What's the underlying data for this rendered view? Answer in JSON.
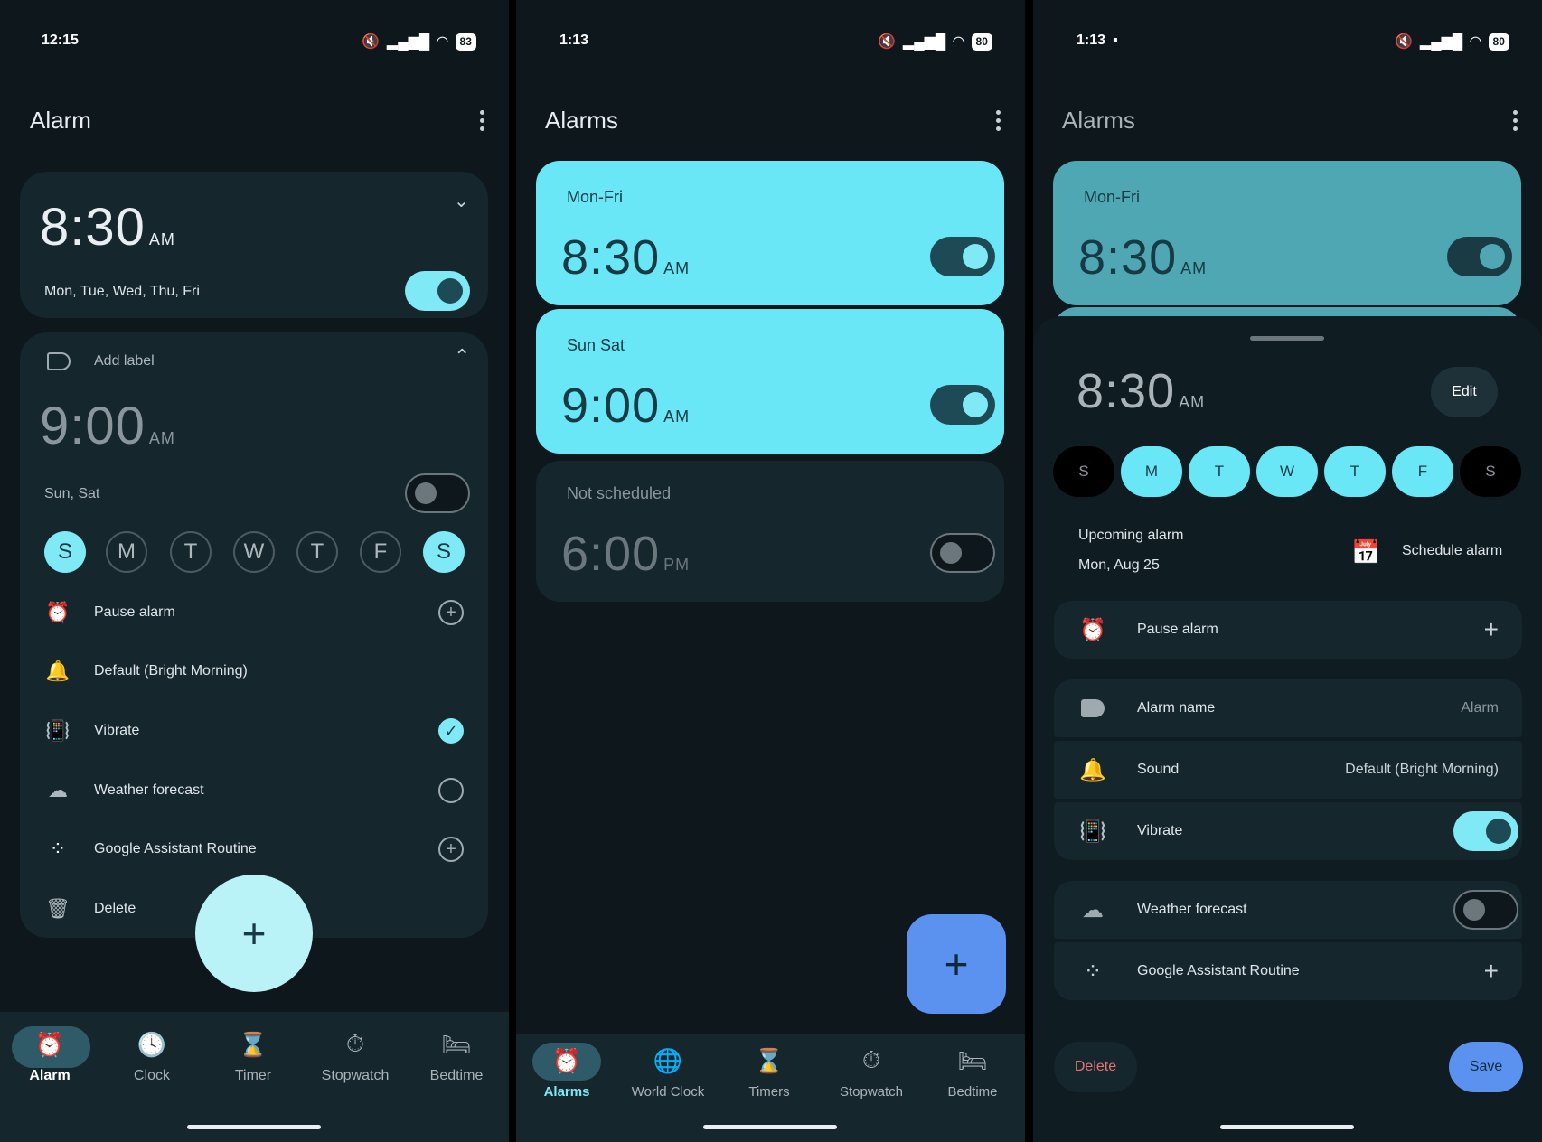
{
  "colors": {
    "accent": "#7feaf6",
    "card_active": "#6ae7f7",
    "fab_blue": "#5b92f0",
    "delete_red": "#e57373"
  },
  "s1": {
    "status": {
      "time": "12:15",
      "battery": "83"
    },
    "title": "Alarm",
    "alarm1": {
      "time": "8:30",
      "ampm": "AM",
      "days": "Mon, Tue, Wed, Thu, Fri",
      "enabled": true
    },
    "alarm2": {
      "label": "Add label",
      "time": "9:00",
      "ampm": "AM",
      "days": "Sun, Sat",
      "enabled": false
    },
    "day_letters": [
      "S",
      "M",
      "T",
      "W",
      "T",
      "F",
      "S"
    ],
    "rows": {
      "pause": "Pause alarm",
      "sound": "Default (Bright Morning)",
      "vibrate": "Vibrate",
      "weather": "Weather forecast",
      "assistant": "Google Assistant Routine",
      "delete": "Delete"
    },
    "nav": [
      "Alarm",
      "Clock",
      "Timer",
      "Stopwatch",
      "Bedtime"
    ]
  },
  "s2": {
    "status": {
      "time": "1:13",
      "battery": "80"
    },
    "title": "Alarms",
    "cards": [
      {
        "label": "Mon-Fri",
        "time": "8:30",
        "ampm": "AM",
        "enabled": true
      },
      {
        "label": "Sun Sat",
        "time": "9:00",
        "ampm": "AM",
        "enabled": true
      },
      {
        "label": "Not scheduled",
        "time": "6:00",
        "ampm": "PM",
        "enabled": false
      }
    ],
    "nav": [
      "Alarms",
      "World Clock",
      "Timers",
      "Stopwatch",
      "Bedtime"
    ]
  },
  "s3": {
    "status": {
      "time": "1:13",
      "battery": "80"
    },
    "title": "Alarms",
    "card": {
      "label": "Mon-Fri",
      "time": "8:30",
      "ampm": "AM",
      "enabled": true
    },
    "sheet": {
      "time": "8:30",
      "ampm": "AM",
      "edit": "Edit",
      "days": [
        "S",
        "M",
        "T",
        "W",
        "T",
        "F",
        "S"
      ],
      "upcoming_label": "Upcoming alarm",
      "upcoming_date": "Mon, Aug 25",
      "schedule": "Schedule alarm",
      "pause": "Pause alarm",
      "alarm_name_label": "Alarm name",
      "alarm_name_value": "Alarm",
      "sound_label": "Sound",
      "sound_value": "Default (Bright Morning)",
      "vibrate": "Vibrate",
      "weather": "Weather forecast",
      "assistant": "Google Assistant Routine",
      "delete": "Delete",
      "save": "Save"
    }
  }
}
